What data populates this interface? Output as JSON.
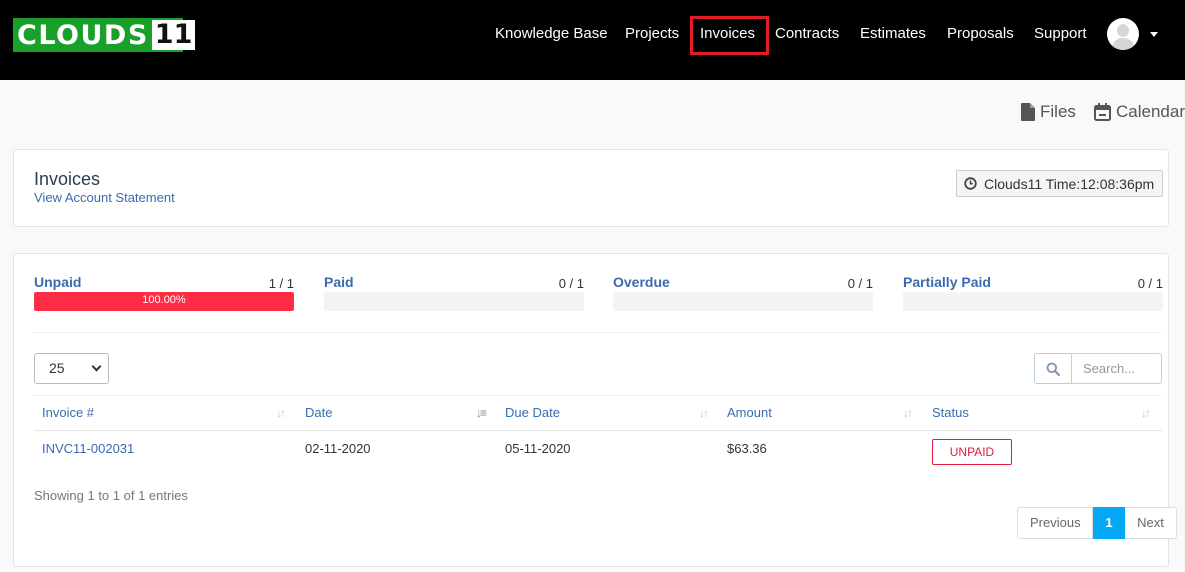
{
  "brand": {
    "text": "CLOUDS",
    "number": "11"
  },
  "nav": {
    "items": [
      "Knowledge Base",
      "Projects",
      "Invoices",
      "Contracts",
      "Estimates",
      "Proposals",
      "Support"
    ],
    "active": "Invoices"
  },
  "utility": {
    "files": "Files",
    "calendar": "Calendar"
  },
  "header": {
    "title": "Invoices",
    "statement_link": "View Account Statement",
    "time": "Clouds11 Time:12:08:36pm"
  },
  "stats": [
    {
      "label": "Unpaid",
      "count": "1 / 1",
      "percent_text": "100.00%",
      "fraction": 1.0,
      "color": "#ff2c45"
    },
    {
      "label": "Paid",
      "count": "0 / 1",
      "percent_text": "",
      "fraction": 0.0,
      "color": "#84c529"
    },
    {
      "label": "Overdue",
      "count": "0 / 1",
      "percent_text": "",
      "fraction": 0.0,
      "color": "#ff6f00"
    },
    {
      "label": "Partially Paid",
      "count": "0 / 1",
      "percent_text": "",
      "fraction": 0.0,
      "color": "#03a9f4"
    }
  ],
  "table": {
    "page_length": "25",
    "search_placeholder": "Search...",
    "columns": [
      "Invoice #",
      "Date",
      "Due Date",
      "Amount",
      "Status"
    ],
    "rows": [
      {
        "invoice": "INVC11-002031",
        "date": "02-11-2020",
        "due_date": "05-11-2020",
        "amount": "$63.36",
        "status": "UNPAID"
      }
    ],
    "showing": "Showing 1 to 1 of 1 entries",
    "pagination": {
      "previous": "Previous",
      "current": "1",
      "next": "Next"
    }
  },
  "colors": {
    "accent": "#03a9f4",
    "link": "#3a6bb0",
    "unpaid": "#e21d3b",
    "highlight": "#e21d24"
  }
}
